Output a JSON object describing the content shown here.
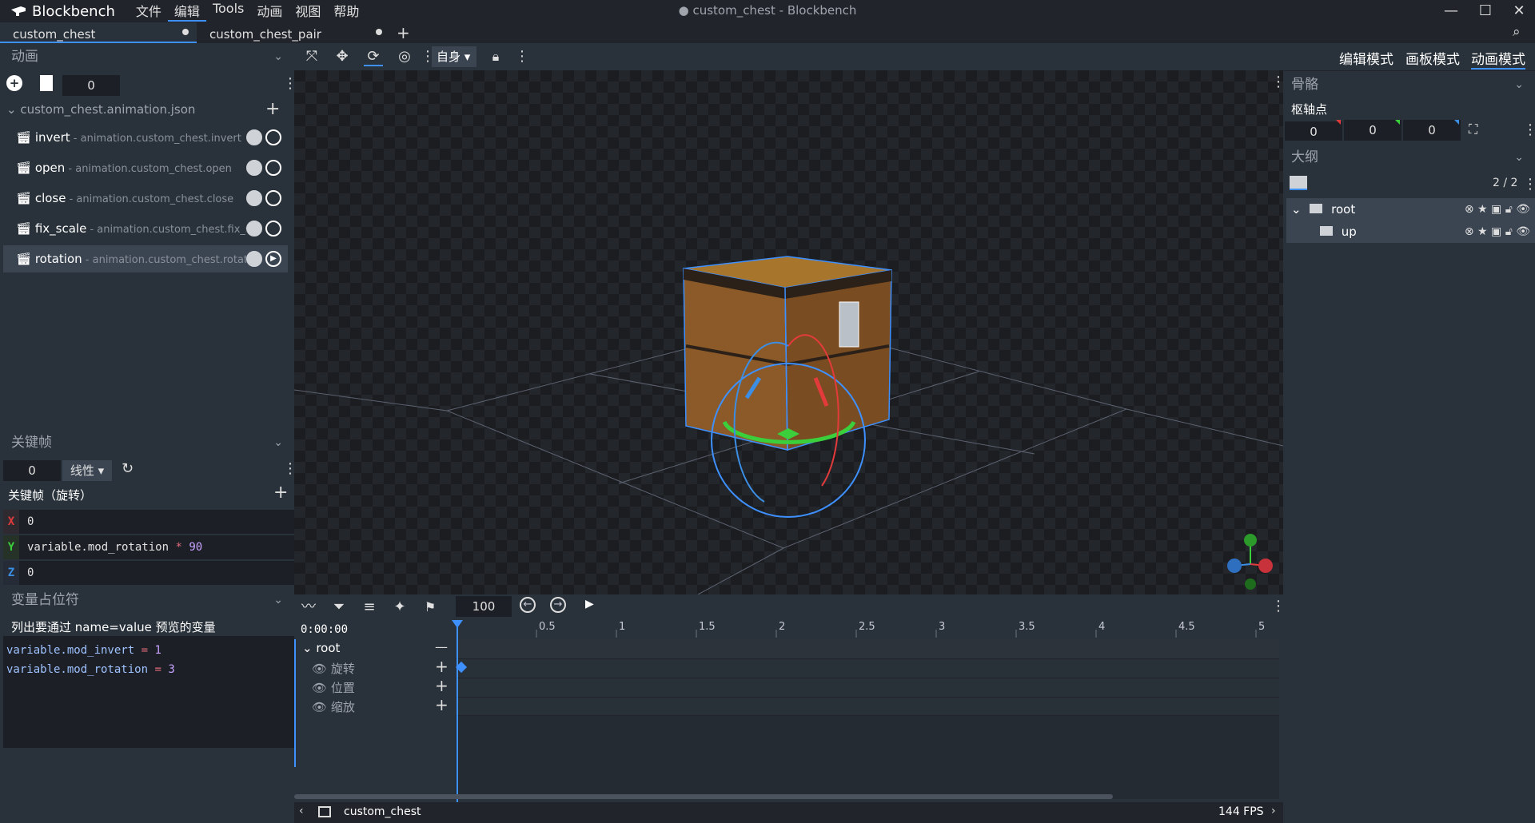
{
  "app": {
    "brand": "Blockbench",
    "window_title": "● custom_chest - Blockbench",
    "menu": [
      "文件",
      "编辑",
      "Tools",
      "动画",
      "视图",
      "帮助"
    ]
  },
  "tabs": [
    {
      "label": "custom_chest",
      "selected": true
    },
    {
      "label": "custom_chest_pair",
      "selected": false
    }
  ],
  "modes": {
    "edit": "编辑模式",
    "paint": "画板模式",
    "animate": "动画模式"
  },
  "toolbar": {
    "space": "自身"
  },
  "animations_panel": {
    "title": "动画",
    "time_value": "0",
    "file": "custom_chest.animation.json",
    "items": [
      {
        "name": "invert",
        "id": " - animation.custom_chest.invert"
      },
      {
        "name": "open",
        "id": " - animation.custom_chest.open"
      },
      {
        "name": "close",
        "id": " - animation.custom_chest.close"
      },
      {
        "name": "fix_scale",
        "id": " - animation.custom_chest.fix_scale"
      },
      {
        "name": "rotation",
        "id": " - animation.custom_chest.rotation"
      }
    ]
  },
  "keyframe_panel": {
    "title": "关键帧",
    "time_value": "0",
    "interpolation": "线性",
    "subtitle": "关键帧（旋转）",
    "x": {
      "label": "X",
      "value": "0"
    },
    "y": {
      "label": "Y",
      "var": "variable.mod_rotation",
      "op": "*",
      "num": "90"
    },
    "z": {
      "label": "Z",
      "value": "0"
    }
  },
  "placeholders_panel": {
    "title": "变量占位符",
    "desc": "列出要通过 name=value 预览的变量",
    "lines": [
      {
        "name": "variable.mod_invert",
        "eq": " = ",
        "val": "1"
      },
      {
        "name": "variable.mod_rotation",
        "eq": " = ",
        "val": "3"
      }
    ]
  },
  "bone_panel": {
    "title": "骨骼",
    "pivot_label": "枢轴点",
    "pivot": [
      "0",
      "0",
      "0"
    ]
  },
  "outliner": {
    "title": "大纲",
    "count": "2 / 2",
    "items": [
      {
        "name": "root"
      },
      {
        "name": "up"
      }
    ]
  },
  "timeline": {
    "speed": "100",
    "time": "0:00:00",
    "ticks": [
      "0.5",
      "1",
      "1.5",
      "2",
      "2.5",
      "3",
      "3.5",
      "4",
      "4.5",
      "5"
    ],
    "group": "root",
    "channels": [
      "旋转",
      "位置",
      "缩放"
    ]
  },
  "status": {
    "model": "custom_chest",
    "fps": "144 FPS"
  },
  "colors": {
    "accent": "#3e90ff",
    "x_axis": "#e33b3b",
    "y_axis": "#3bcf3b",
    "z_axis": "#3b8ee3"
  }
}
